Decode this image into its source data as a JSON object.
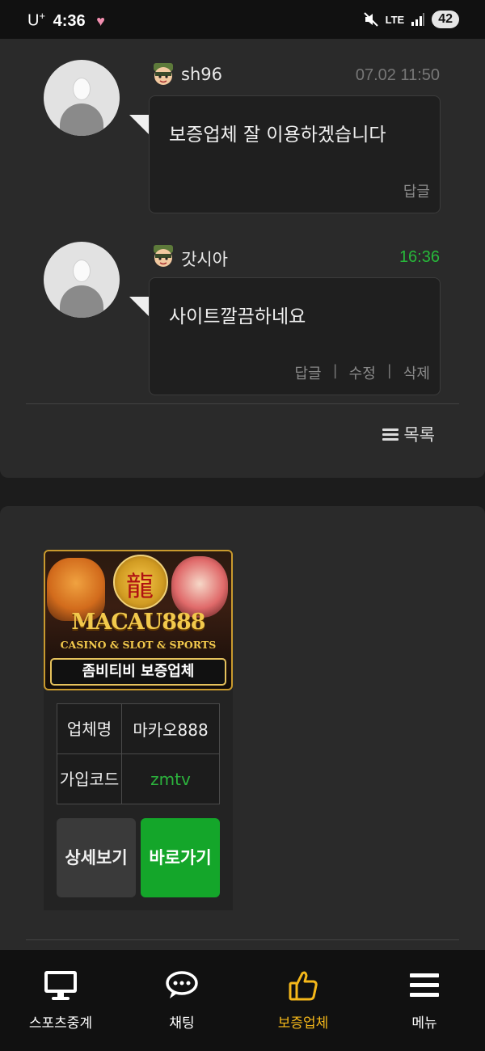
{
  "status_bar": {
    "carrier": "U",
    "carrier_sup": "+",
    "time": "4:36",
    "network": "LTE",
    "battery": "42"
  },
  "comments": [
    {
      "username": "sh96",
      "time": "07.02 11:50",
      "text": "보증업체 잘 이용하겠습니다",
      "actions": [
        "답글"
      ]
    },
    {
      "username": "갓시아",
      "time": "16:36",
      "text": "사이트깔끔하네요",
      "actions": [
        "답글",
        "수정",
        "삭제"
      ]
    }
  ],
  "list_button_label": "목록",
  "partner": {
    "banner_title": "MACAU888",
    "banner_subtitle": "CASINO & SLOT & SPORTS",
    "banner_tag": "좀비티비 보증업체",
    "name_label": "업체명",
    "name_value": "마카오888",
    "code_label": "가입코드",
    "code_value": "zmtv",
    "detail_button": "상세보기",
    "go_button": "바로가기"
  },
  "bottom_nav": [
    {
      "label": "스포츠중계",
      "icon": "monitor-icon"
    },
    {
      "label": "채팅",
      "icon": "chat-bubble-icon"
    },
    {
      "label": "보증업체",
      "icon": "thumbs-up-icon",
      "active": true
    },
    {
      "label": "메뉴",
      "icon": "hamburger-menu-icon"
    }
  ],
  "colors": {
    "accent_green": "#14a62a",
    "active_nav": "#f5b81a",
    "gold": "#f2c94c"
  }
}
